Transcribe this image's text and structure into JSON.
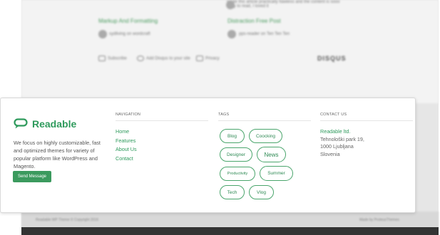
{
  "background": {
    "posts": [
      {
        "title": "Markup And Formatting",
        "meta": "sydliving on wordcraft"
      },
      {
        "title": "Distraction Free Post",
        "meta": "pps-reader on Ten Ten Ten"
      }
    ],
    "comment_text": "wrote this article practically flawless and the content is sooo easy to read, I loved it",
    "disqus_actions": [
      "Subscribe",
      "Add Disqus to your site",
      "Privacy"
    ],
    "disqus_logo": "DISQUS",
    "footer_left": "Readable WP Theme © Copyright 2016",
    "footer_right": "Made by ProteusThemes"
  },
  "brand": {
    "name": "Readable",
    "about": "We focus on highly customizable, fast and optimized themes for variety of popular platform like WordPress and Magento.",
    "button": "Send Message"
  },
  "navigation": {
    "heading": "NAVIGATION",
    "items": [
      "Home",
      "Features",
      "About Us",
      "Contact"
    ]
  },
  "tags": {
    "heading": "TAGS",
    "items": [
      "Blog",
      "Coocking",
      "Designer",
      "News",
      "Productivity",
      "Summer",
      "Tech",
      "Vlog"
    ]
  },
  "contact": {
    "heading": "CONTACT US",
    "company": "Readable ltd.",
    "street": "Tehnološki park 19,",
    "city": "1000 Ljubljana",
    "country": "Slovenia"
  },
  "colors": {
    "accent": "#2e9a5c",
    "button": "#3b9a5e",
    "footer_bar": "#333333"
  }
}
